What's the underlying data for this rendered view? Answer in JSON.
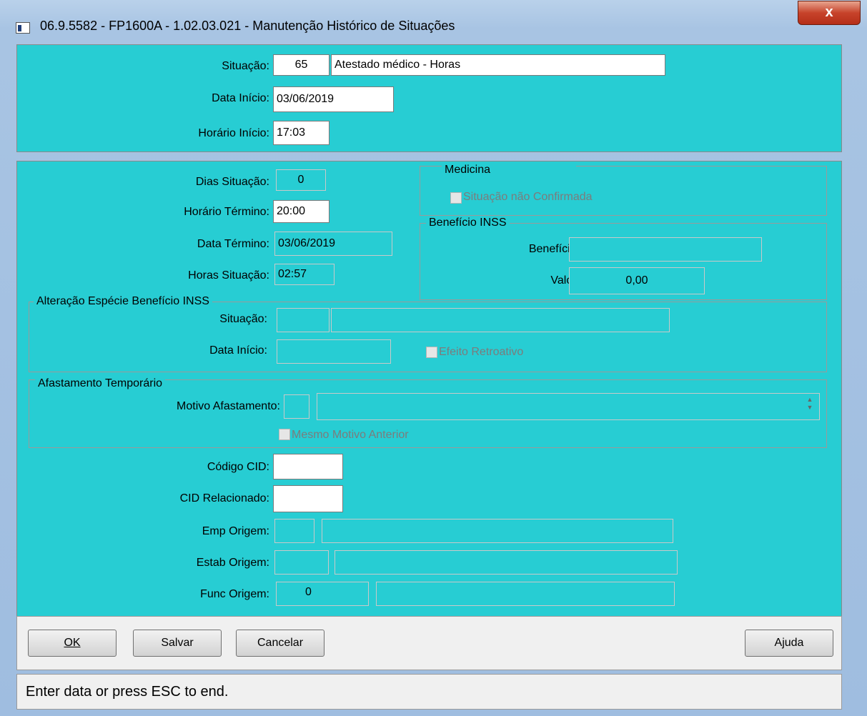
{
  "window": {
    "title": "06.9.5582 - FP1600A - 1.02.03.021 - Manutenção Histórico de Situações",
    "close_label": "x"
  },
  "top": {
    "situacao_label": "Situação:",
    "situacao_code": "65",
    "situacao_desc": "Atestado médico - Horas",
    "data_inicio_label": "Data Início:",
    "data_inicio": "03/06/2019",
    "horario_inicio_label": "Horário Início:",
    "horario_inicio": "17:03"
  },
  "main": {
    "dias_situacao_label": "Dias Situação:",
    "dias_situacao": "0",
    "horario_termino_label": "Horário Término:",
    "horario_termino": "20:00",
    "data_termino_label": "Data Término:",
    "data_termino": "03/06/2019",
    "horas_situacao_label": "Horas Situação:",
    "horas_situacao": "02:57",
    "medicina": {
      "title": "Medicina",
      "situacao_nao_confirmada": "Situação não Confirmada"
    },
    "beneficio_inss": {
      "title": "Benefício INSS",
      "beneficio_label": "Benefício:",
      "beneficio": "",
      "valor_label": "Valor:",
      "valor": "0,00"
    },
    "alteracao": {
      "title": "Alteração Espécie Benefício INSS",
      "situacao_label": "Situação:",
      "situacao_code": "",
      "situacao_desc": "",
      "data_inicio_label": "Data Início:",
      "data_inicio": "",
      "efeito_retroativo": "Efeito Retroativo"
    },
    "afastamento": {
      "title": "Afastamento Temporário",
      "motivo_label": "Motivo Afastamento:",
      "motivo_code": "",
      "motivo_desc": "",
      "mesmo_motivo": "Mesmo Motivo Anterior"
    },
    "codigo_cid_label": "Código CID:",
    "codigo_cid": "",
    "cid_relacionado_label": "CID Relacionado:",
    "cid_relacionado": "",
    "emp_origem_label": "Emp Origem:",
    "emp_origem_code": "",
    "emp_origem_desc": "",
    "estab_origem_label": "Estab Origem:",
    "estab_origem_code": "",
    "estab_origem_desc": "",
    "func_origem_label": "Func Origem:",
    "func_origem_code": "0",
    "func_origem_desc": ""
  },
  "buttons": {
    "ok": "OK",
    "salvar": "Salvar",
    "cancelar": "Cancelar",
    "ajuda": "Ajuda"
  },
  "status": {
    "message": "Enter data or press ESC to end."
  }
}
